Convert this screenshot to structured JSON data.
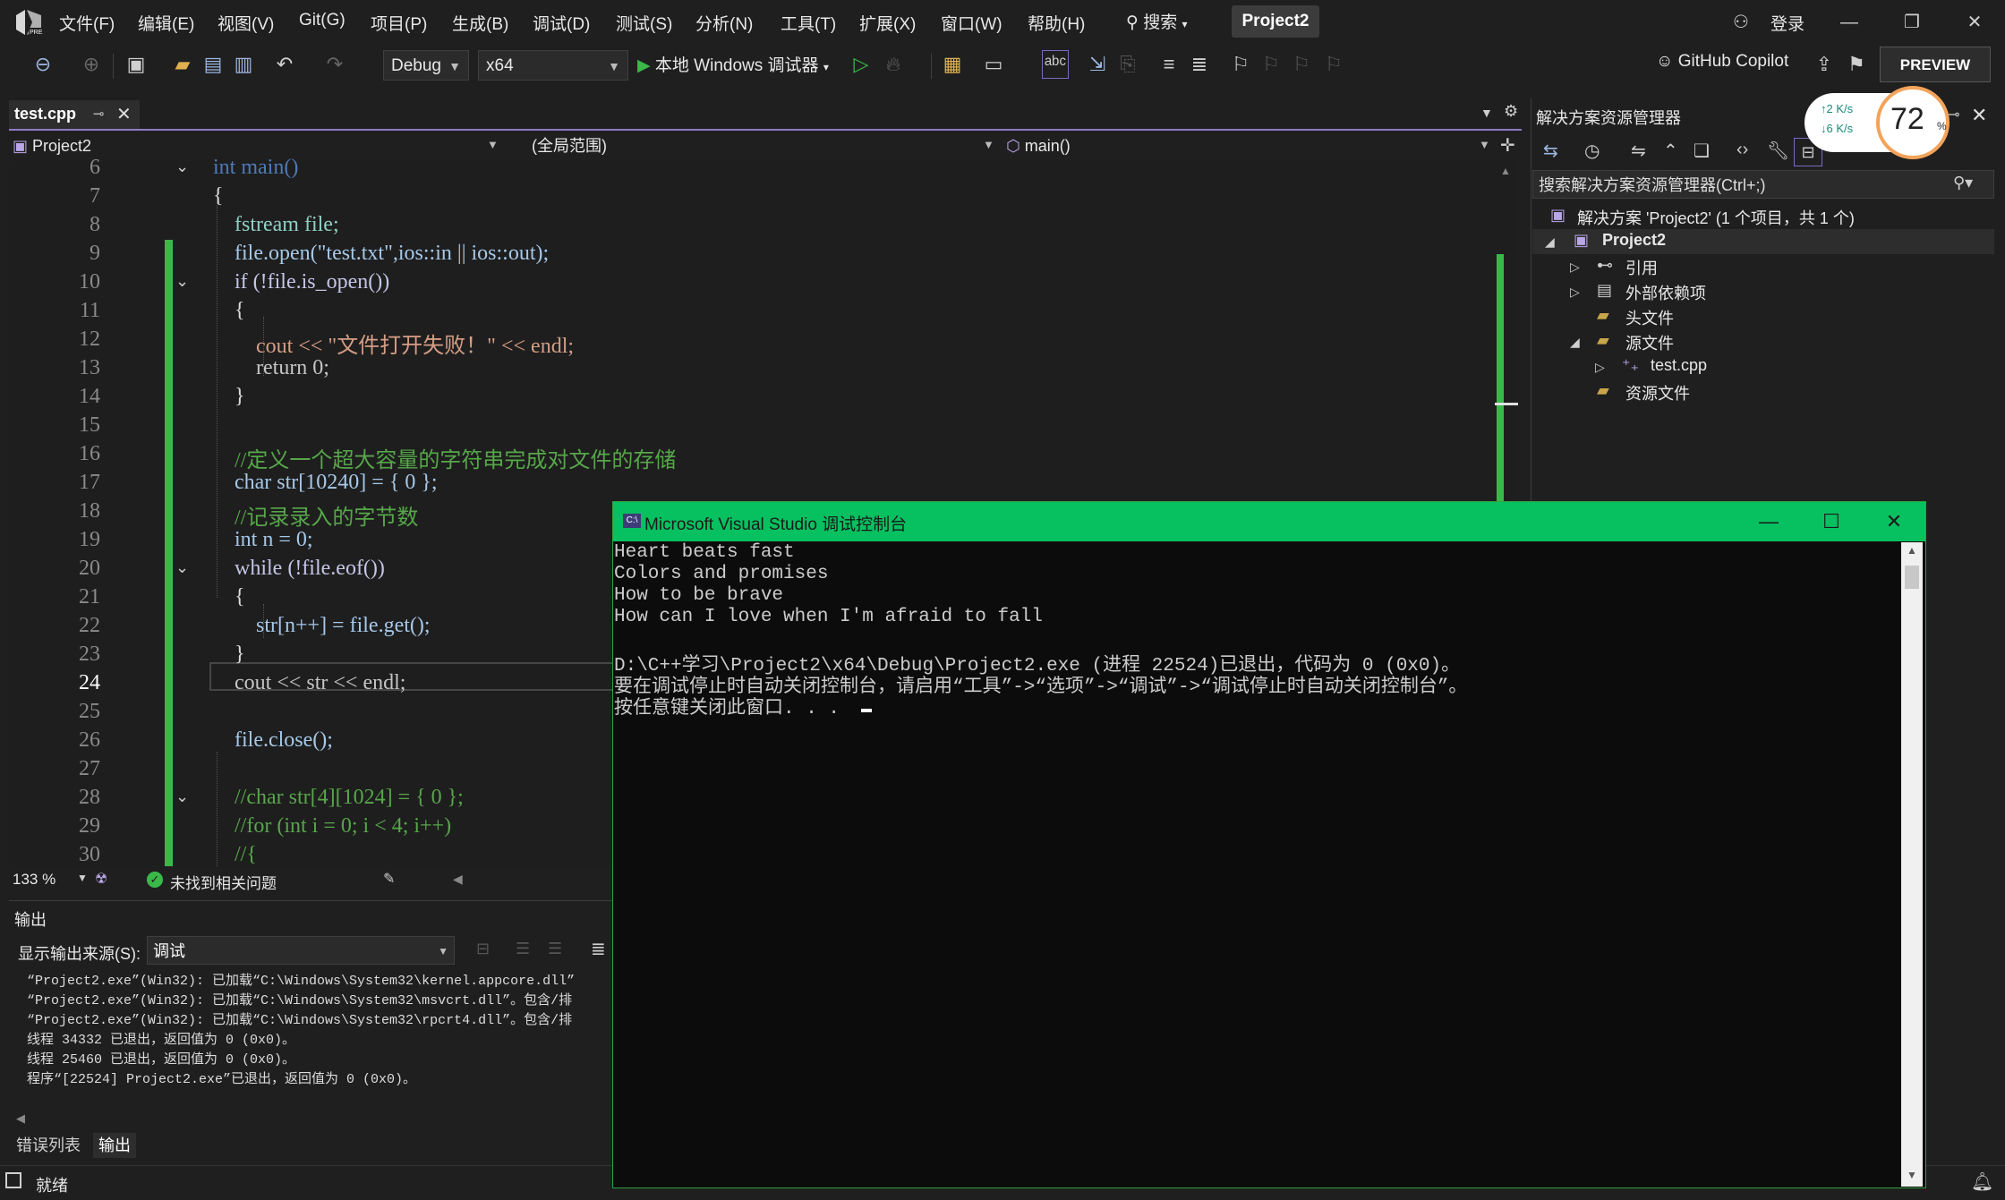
{
  "menu": [
    "文件(F)",
    "编辑(E)",
    "视图(V)",
    "Git(G)",
    "项目(P)",
    "生成(B)",
    "调试(D)",
    "测试(S)",
    "分析(N)",
    "工具(T)",
    "扩展(X)",
    "窗口(W)",
    "帮助(H)"
  ],
  "search_label": "搜索",
  "project_name": "Project2",
  "login": "登录",
  "toolbar": {
    "config": "Debug",
    "platform": "x64",
    "run_label": "本地 Windows 调试器",
    "copilot": "GitHub Copilot",
    "preview": "PREVIEW"
  },
  "editor": {
    "tab": "test.cpp",
    "nav_project": "Project2",
    "nav_scope": "(全局范围)",
    "nav_member": "main()",
    "zoom": "133 %",
    "issues": "未找到相关问题",
    "active_line": "24",
    "lines": [
      {
        "n": "6",
        "code": "int main()"
      },
      {
        "n": "7",
        "code": "{"
      },
      {
        "n": "8",
        "code": "    fstream file;"
      },
      {
        "n": "9",
        "code": "    file.open(\"test.txt\",ios::in || ios::out);"
      },
      {
        "n": "10",
        "code": "    if (!file.is_open())"
      },
      {
        "n": "11",
        "code": "    {"
      },
      {
        "n": "12",
        "code": "        cout << \"文件打开失败！\" << endl;"
      },
      {
        "n": "13",
        "code": "        return 0;"
      },
      {
        "n": "14",
        "code": "    }"
      },
      {
        "n": "15",
        "code": ""
      },
      {
        "n": "16",
        "code": "    //定义一个超大容量的字符串完成对文件的存储"
      },
      {
        "n": "17",
        "code": "    char str[10240] = { 0 };"
      },
      {
        "n": "18",
        "code": "    //记录录入的字节数"
      },
      {
        "n": "19",
        "code": "    int n = 0;"
      },
      {
        "n": "20",
        "code": "    while (!file.eof())"
      },
      {
        "n": "21",
        "code": "    {"
      },
      {
        "n": "22",
        "code": "        str[n++] = file.get();"
      },
      {
        "n": "23",
        "code": "    }"
      },
      {
        "n": "24",
        "code": "    cout << str << endl;"
      },
      {
        "n": "25",
        "code": ""
      },
      {
        "n": "26",
        "code": "    file.close();"
      },
      {
        "n": "27",
        "code": ""
      },
      {
        "n": "28",
        "code": "    //char str[4][1024] = { 0 };"
      },
      {
        "n": "29",
        "code": "    //for (int i = 0; i < 4; i++)"
      },
      {
        "n": "30",
        "code": "    //{"
      }
    ]
  },
  "output": {
    "title": "输出",
    "source_label": "显示输出来源(S):",
    "source_value": "调试",
    "lines": [
      "“Project2.exe”(Win32): 已加载“C:\\Windows\\System32\\kernel.appcore.dll”",
      "“Project2.exe”(Win32): 已加载“C:\\Windows\\System32\\msvcrt.dll”。包含/排",
      "“Project2.exe”(Win32): 已加载“C:\\Windows\\System32\\rpcrt4.dll”。包含/排",
      "线程 34332 已退出，返回值为 0 (0x0)。",
      "线程 25460 已退出，返回值为 0 (0x0)。",
      "程序“[22524] Project2.exe”已退出，返回值为 0 (0x0)。"
    ],
    "tabs": [
      "错误列表",
      "输出"
    ]
  },
  "status": "就绪",
  "solution_explorer": {
    "title": "解决方案资源管理器",
    "search_placeholder": "搜索解决方案资源管理器(Ctrl+;)",
    "items": [
      "解决方案 'Project2' (1 个项目，共 1 个)",
      "Project2",
      "引用",
      "外部依赖项",
      "头文件",
      "源文件",
      "test.cpp",
      "资源文件"
    ]
  },
  "net_widget": {
    "up": "2  K/s",
    "down": "6  K/s",
    "percent": "72",
    "percent_symbol": "%"
  },
  "console": {
    "title": "Microsoft Visual Studio 调试控制台",
    "lines": [
      "Heart beats fast",
      "Colors and promises",
      "How to be brave",
      "How can I love when I'm afraid to fall",
      "",
      "D:\\C++学习\\Project2\\x64\\Debug\\Project2.exe (进程 22524)已退出，代码为 0 (0x0)。",
      "要在调试停止时自动关闭控制台，请启用“工具”->“选项”->“调试”->“调试停止时自动关闭控制台”。",
      "按任意键关闭此窗口. . ."
    ]
  }
}
